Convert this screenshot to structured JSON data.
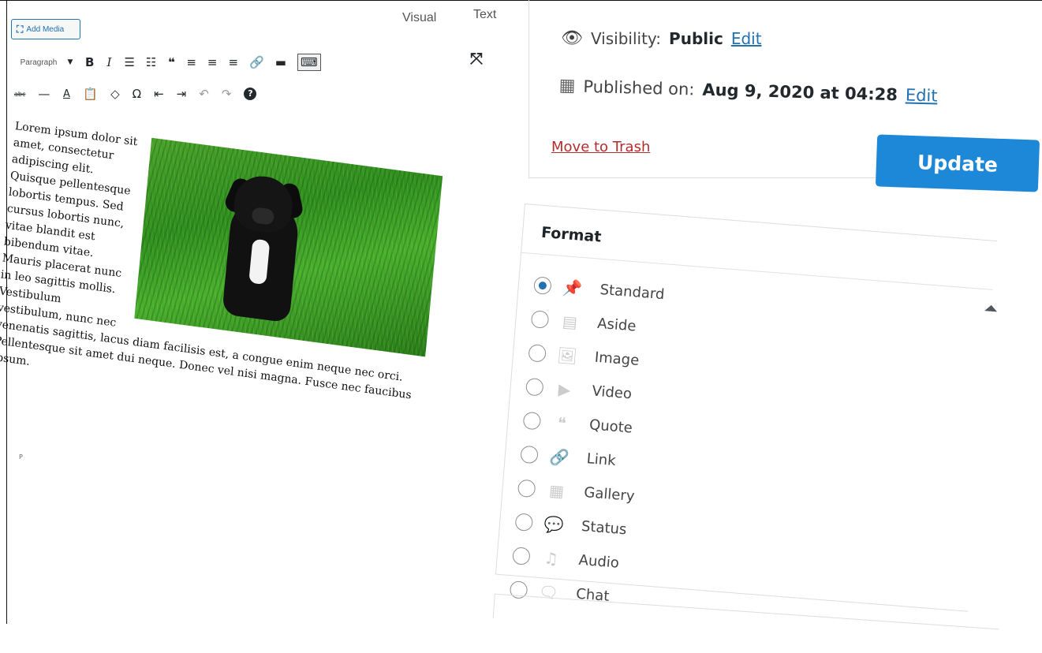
{
  "editor": {
    "add_media": "Add Media",
    "add_media_icon": "media-icon",
    "tabs": [
      "Visual",
      "Text"
    ],
    "toolbar_row1": {
      "format_select": "Paragraph",
      "buttons": [
        {
          "icon": "bold-icon",
          "glyph": "B"
        },
        {
          "icon": "italic-icon",
          "glyph": "I"
        },
        {
          "icon": "bulleted-list-icon",
          "glyph": "☰"
        },
        {
          "icon": "numbered-list-icon",
          "glyph": "☷"
        },
        {
          "icon": "blockquote-icon",
          "glyph": "❝"
        },
        {
          "icon": "align-left-icon",
          "glyph": "≡"
        },
        {
          "icon": "align-center-icon",
          "glyph": "≡"
        },
        {
          "icon": "align-right-icon",
          "glyph": "≡"
        },
        {
          "icon": "link-icon",
          "glyph": "🔗"
        },
        {
          "icon": "read-more-icon",
          "glyph": "▬"
        },
        {
          "icon": "toolbar-toggle-icon",
          "glyph": "⌨"
        }
      ],
      "fullscreen_icon": "fullscreen-icon"
    },
    "toolbar_row2": [
      {
        "icon": "strikethrough-icon",
        "glyph": "abc"
      },
      {
        "icon": "horizontal-line-icon",
        "glyph": "—"
      },
      {
        "icon": "text-color-icon",
        "glyph": "A"
      },
      {
        "icon": "paste-text-icon",
        "glyph": "📋"
      },
      {
        "icon": "clear-formatting-icon",
        "glyph": "◇"
      },
      {
        "icon": "special-character-icon",
        "glyph": "Ω"
      },
      {
        "icon": "outdent-icon",
        "glyph": "⇤"
      },
      {
        "icon": "indent-icon",
        "glyph": "⇥"
      },
      {
        "icon": "undo-icon",
        "glyph": "↶"
      },
      {
        "icon": "redo-icon",
        "glyph": "↷"
      },
      {
        "icon": "help-icon",
        "glyph": "?"
      }
    ],
    "body_text": "Lorem ipsum dolor sit amet, consectetur adipiscing elit. Quisque pellentesque lobortis tempus. Sed cursus lobortis nunc, vitae blandit est bibendum vitae. Mauris placerat nunc in leo sagittis mollis. Vestibulum vestibulum, nunc nec venenatis sagittis, lacus diam facilisis est, a congue enim neque nec orci. Pellentesque sit amet dui neque. Donec vel nisi magna. Fusce nec faucibus ipsum.",
    "path_marker": "P"
  },
  "publish": {
    "visibility_label": "Visibility:",
    "visibility_value": "Public",
    "visibility_edit": "Edit",
    "published_label": "Published on:",
    "published_value": "Aug 9, 2020 at 04:28",
    "published_edit": "Edit",
    "trash": "Move to Trash",
    "update": "Update"
  },
  "format": {
    "title": "Format",
    "options": [
      {
        "label": "Standard",
        "icon": "pin-icon",
        "glyph": "📌",
        "selected": true
      },
      {
        "label": "Aside",
        "icon": "aside-icon",
        "glyph": "▤",
        "selected": false
      },
      {
        "label": "Image",
        "icon": "image-icon",
        "glyph": "🖼",
        "selected": false
      },
      {
        "label": "Video",
        "icon": "video-icon",
        "glyph": "▶",
        "selected": false
      },
      {
        "label": "Quote",
        "icon": "quote-icon",
        "glyph": "❝",
        "selected": false
      },
      {
        "label": "Link",
        "icon": "link-icon",
        "glyph": "🔗",
        "selected": false
      },
      {
        "label": "Gallery",
        "icon": "gallery-icon",
        "glyph": "▦",
        "selected": false
      },
      {
        "label": "Status",
        "icon": "status-icon",
        "glyph": "💬",
        "selected": false
      },
      {
        "label": "Audio",
        "icon": "audio-icon",
        "glyph": "♫",
        "selected": false
      },
      {
        "label": "Chat",
        "icon": "chat-icon",
        "glyph": "🗨",
        "selected": false
      }
    ]
  },
  "colors": {
    "accent": "#2271b1",
    "update_button": "#1e88d8",
    "trash": "#b32d2e"
  }
}
